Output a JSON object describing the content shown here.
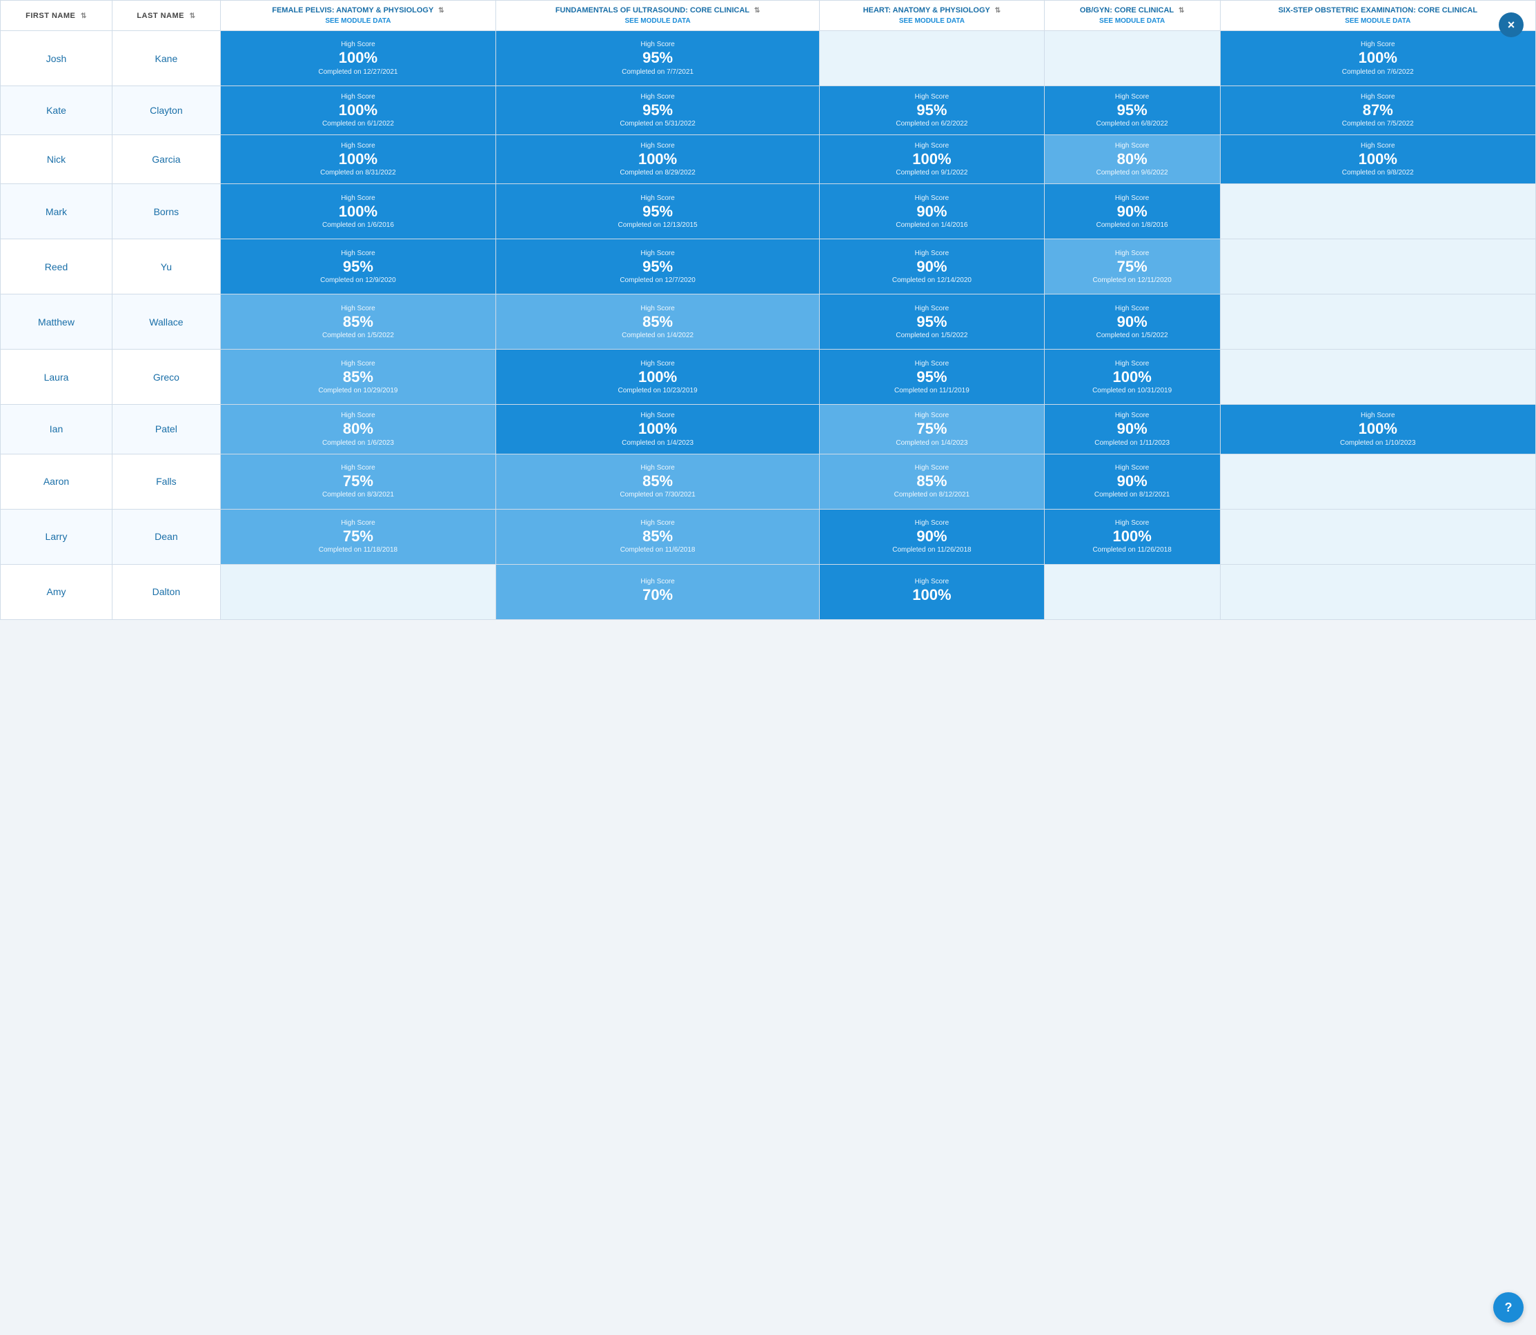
{
  "close_button_label": "×",
  "support_button_label": "?",
  "columns": {
    "first_name": "FIRST NAME",
    "last_name": "LAST NAME",
    "col1": {
      "title": "FEMALE PELVIS: ANATOMY & PHYSIOLOGY",
      "module_link": "SEE MODULE DATA"
    },
    "col2": {
      "title": "FUNDAMENTALS OF ULTRASOUND: CORE CLINICAL",
      "module_link": "SEE MODULE DATA"
    },
    "col3": {
      "title": "HEART: ANATOMY & PHYSIOLOGY",
      "module_link": "SEE MODULE DATA"
    },
    "col4": {
      "title": "OB/GYN: CORE CLINICAL",
      "module_link": "SEE MODULE DATA"
    },
    "col5": {
      "title": "SIX-STEP OBSTETRIC EXAMINATION: CORE CLINICAL",
      "module_link": "SEE MODULE DATA"
    }
  },
  "rows": [
    {
      "first": "Josh",
      "last": "Kane",
      "col1": {
        "score": "100%",
        "date": "Completed on 12/27/2021",
        "shade": "dark"
      },
      "col2": {
        "score": "95%",
        "date": "Completed on 7/7/2021",
        "shade": "dark"
      },
      "col3": null,
      "col4": null,
      "col5": {
        "score": "100%",
        "date": "Completed on 7/6/2022",
        "shade": "dark"
      }
    },
    {
      "first": "Kate",
      "last": "Clayton",
      "col1": {
        "score": "100%",
        "date": "Completed on 6/1/2022",
        "shade": "dark"
      },
      "col2": {
        "score": "95%",
        "date": "Completed on 5/31/2022",
        "shade": "dark"
      },
      "col3": {
        "score": "95%",
        "date": "Completed on 6/2/2022",
        "shade": "dark"
      },
      "col4": {
        "score": "95%",
        "date": "Completed on 6/8/2022",
        "shade": "dark"
      },
      "col5": {
        "score": "87%",
        "date": "Completed on 7/5/2022",
        "shade": "dark"
      }
    },
    {
      "first": "Nick",
      "last": "Garcia",
      "col1": {
        "score": "100%",
        "date": "Completed on 8/31/2022",
        "shade": "dark"
      },
      "col2": {
        "score": "100%",
        "date": "Completed on 8/29/2022",
        "shade": "dark"
      },
      "col3": {
        "score": "100%",
        "date": "Completed on 9/1/2022",
        "shade": "dark"
      },
      "col4": {
        "score": "80%",
        "date": "Completed on 9/6/2022",
        "shade": "light"
      },
      "col5": {
        "score": "100%",
        "date": "Completed on 9/8/2022",
        "shade": "dark"
      }
    },
    {
      "first": "Mark",
      "last": "Borns",
      "col1": {
        "score": "100%",
        "date": "Completed on 1/6/2016",
        "shade": "dark"
      },
      "col2": {
        "score": "95%",
        "date": "Completed on 12/13/2015",
        "shade": "dark"
      },
      "col3": {
        "score": "90%",
        "date": "Completed on 1/4/2016",
        "shade": "dark"
      },
      "col4": {
        "score": "90%",
        "date": "Completed on 1/8/2016",
        "shade": "dark"
      },
      "col5": null
    },
    {
      "first": "Reed",
      "last": "Yu",
      "col1": {
        "score": "95%",
        "date": "Completed on 12/9/2020",
        "shade": "dark"
      },
      "col2": {
        "score": "95%",
        "date": "Completed on 12/7/2020",
        "shade": "dark"
      },
      "col3": {
        "score": "90%",
        "date": "Completed on 12/14/2020",
        "shade": "dark"
      },
      "col4": {
        "score": "75%",
        "date": "Completed on 12/11/2020",
        "shade": "light"
      },
      "col5": null
    },
    {
      "first": "Matthew",
      "last": "Wallace",
      "col1": {
        "score": "85%",
        "date": "Completed on 1/5/2022",
        "shade": "light"
      },
      "col2": {
        "score": "85%",
        "date": "Completed on 1/4/2022",
        "shade": "light"
      },
      "col3": {
        "score": "95%",
        "date": "Completed on 1/5/2022",
        "shade": "dark"
      },
      "col4": {
        "score": "90%",
        "date": "Completed on 1/5/2022",
        "shade": "dark"
      },
      "col5": null
    },
    {
      "first": "Laura",
      "last": "Greco",
      "col1": {
        "score": "85%",
        "date": "Completed on 10/29/2019",
        "shade": "light"
      },
      "col2": {
        "score": "100%",
        "date": "Completed on 10/23/2019",
        "shade": "dark"
      },
      "col3": {
        "score": "95%",
        "date": "Completed on 11/1/2019",
        "shade": "dark"
      },
      "col4": {
        "score": "100%",
        "date": "Completed on 10/31/2019",
        "shade": "dark"
      },
      "col5": null
    },
    {
      "first": "Ian",
      "last": "Patel",
      "col1": {
        "score": "80%",
        "date": "Completed on 1/6/2023",
        "shade": "light"
      },
      "col2": {
        "score": "100%",
        "date": "Completed on 1/4/2023",
        "shade": "dark"
      },
      "col3": {
        "score": "75%",
        "date": "Completed on 1/4/2023",
        "shade": "light"
      },
      "col4": {
        "score": "90%",
        "date": "Completed on 1/11/2023",
        "shade": "dark"
      },
      "col5": {
        "score": "100%",
        "date": "Completed on 1/10/2023",
        "shade": "dark"
      }
    },
    {
      "first": "Aaron",
      "last": "Falls",
      "col1": {
        "score": "75%",
        "date": "Completed on 8/3/2021",
        "shade": "light"
      },
      "col2": {
        "score": "85%",
        "date": "Completed on 7/30/2021",
        "shade": "light"
      },
      "col3": {
        "score": "85%",
        "date": "Completed on 8/12/2021",
        "shade": "light"
      },
      "col4": {
        "score": "90%",
        "date": "Completed on 8/12/2021",
        "shade": "dark"
      },
      "col5": null
    },
    {
      "first": "Larry",
      "last": "Dean",
      "col1": {
        "score": "75%",
        "date": "Completed on 11/18/2018",
        "shade": "light"
      },
      "col2": {
        "score": "85%",
        "date": "Completed on 11/6/2018",
        "shade": "light"
      },
      "col3": {
        "score": "90%",
        "date": "Completed on 11/26/2018",
        "shade": "dark"
      },
      "col4": {
        "score": "100%",
        "date": "Completed on 11/26/2018",
        "shade": "dark"
      },
      "col5": null
    },
    {
      "first": "Amy",
      "last": "Dalton",
      "col1": null,
      "col2": {
        "score": "70%",
        "date": "",
        "shade": "light"
      },
      "col3": {
        "score": "100%",
        "date": "",
        "shade": "dark"
      },
      "col4": null,
      "col5": null
    }
  ],
  "high_score_label": "High Score"
}
